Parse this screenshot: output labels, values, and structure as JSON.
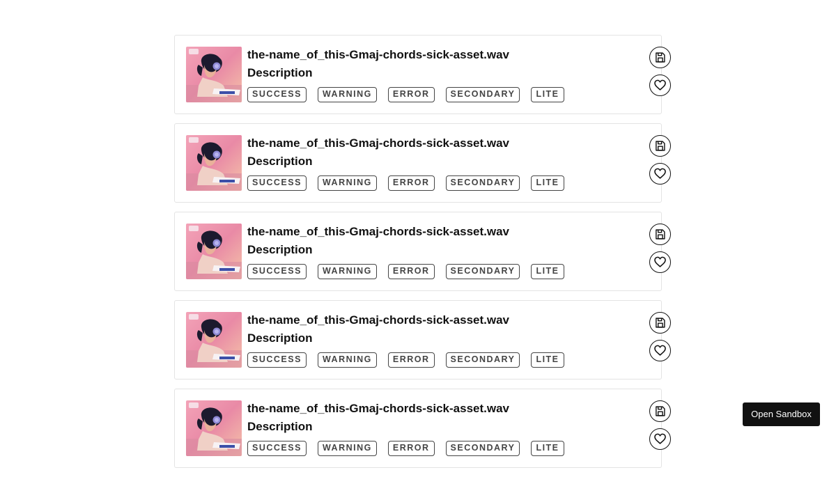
{
  "assets": [
    {
      "title": "the-name_of_this-Gmaj-chords-sick-asset.wav",
      "description": "Description",
      "badges": [
        "SUCCESS",
        "WARNING",
        "ERROR",
        "SECONDARY",
        "LITE"
      ],
      "thumbnail_icon": "artwork-thumbnail",
      "actions": [
        "save-icon",
        "heart-icon"
      ]
    },
    {
      "title": "the-name_of_this-Gmaj-chords-sick-asset.wav",
      "description": "Description",
      "badges": [
        "SUCCESS",
        "WARNING",
        "ERROR",
        "SECONDARY",
        "LITE"
      ],
      "thumbnail_icon": "artwork-thumbnail",
      "actions": [
        "save-icon",
        "heart-icon"
      ]
    },
    {
      "title": "the-name_of_this-Gmaj-chords-sick-asset.wav",
      "description": "Description",
      "badges": [
        "SUCCESS",
        "WARNING",
        "ERROR",
        "SECONDARY",
        "LITE"
      ],
      "thumbnail_icon": "artwork-thumbnail",
      "actions": [
        "save-icon",
        "heart-icon"
      ]
    },
    {
      "title": "the-name_of_this-Gmaj-chords-sick-asset.wav",
      "description": "Description",
      "badges": [
        "SUCCESS",
        "WARNING",
        "ERROR",
        "SECONDARY",
        "LITE"
      ],
      "thumbnail_icon": "artwork-thumbnail",
      "actions": [
        "save-icon",
        "heart-icon"
      ]
    },
    {
      "title": "the-name_of_this-Gmaj-chords-sick-asset.wav",
      "description": "Description",
      "badges": [
        "SUCCESS",
        "WARNING",
        "ERROR",
        "SECONDARY",
        "LITE"
      ],
      "thumbnail_icon": "artwork-thumbnail",
      "actions": [
        "save-icon",
        "heart-icon"
      ]
    }
  ],
  "sandbox_button": {
    "label": "Open Sandbox"
  },
  "colors": {
    "text": "#111111",
    "badge_border": "#444444",
    "card_border": "#e3e3e3",
    "sandbox_bg": "#111111",
    "sandbox_text": "#ffffff"
  }
}
